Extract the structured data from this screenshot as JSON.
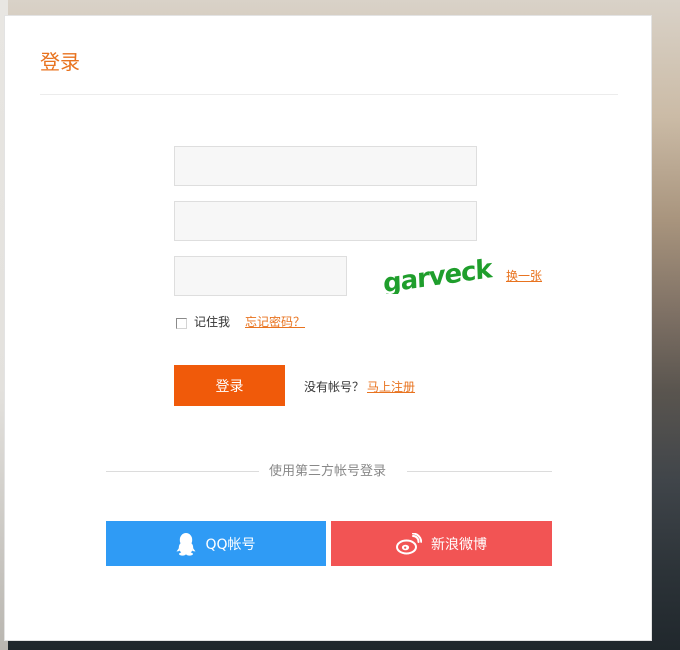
{
  "title": "登录",
  "form": {
    "username_placeholder": "",
    "password_placeholder": "",
    "captcha_placeholder": "",
    "captcha_text": "garveck",
    "swap_captcha": "换一张",
    "remember_me": "记住我",
    "forgot_password": "忘记密码？",
    "login_button": "登录",
    "no_account": "没有帐号？",
    "register": "马上注册"
  },
  "third_party": {
    "divider_text": "使用第三方帐号登录",
    "qq_label": "QQ帐号",
    "weibo_label": "新浪微博"
  },
  "colors": {
    "accent": "#e8731f",
    "login_button": "#f05a0a",
    "qq": "#2f9bf5",
    "weibo": "#f25454",
    "captcha_green": "#1f9e2c"
  }
}
